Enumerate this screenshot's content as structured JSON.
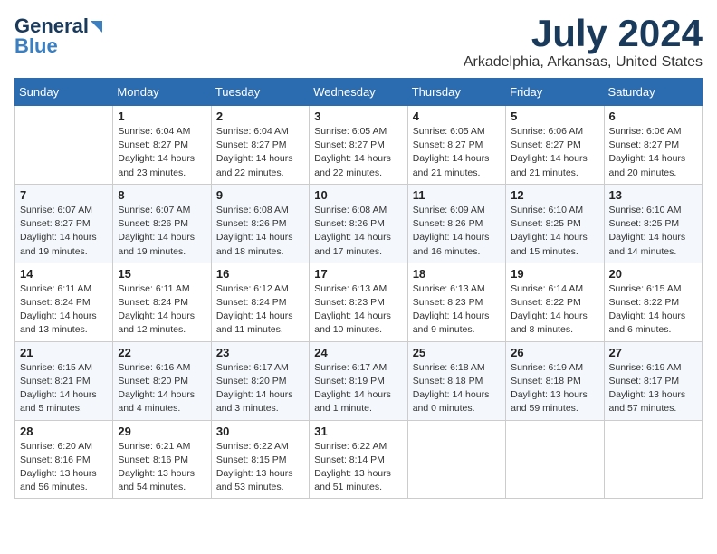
{
  "logo": {
    "line1": "General",
    "line2": "Blue"
  },
  "header": {
    "month_year": "July 2024",
    "location": "Arkadelphia, Arkansas, United States"
  },
  "weekdays": [
    "Sunday",
    "Monday",
    "Tuesday",
    "Wednesday",
    "Thursday",
    "Friday",
    "Saturday"
  ],
  "weeks": [
    [
      {
        "day": "",
        "info": ""
      },
      {
        "day": "1",
        "info": "Sunrise: 6:04 AM\nSunset: 8:27 PM\nDaylight: 14 hours\nand 23 minutes."
      },
      {
        "day": "2",
        "info": "Sunrise: 6:04 AM\nSunset: 8:27 PM\nDaylight: 14 hours\nand 22 minutes."
      },
      {
        "day": "3",
        "info": "Sunrise: 6:05 AM\nSunset: 8:27 PM\nDaylight: 14 hours\nand 22 minutes."
      },
      {
        "day": "4",
        "info": "Sunrise: 6:05 AM\nSunset: 8:27 PM\nDaylight: 14 hours\nand 21 minutes."
      },
      {
        "day": "5",
        "info": "Sunrise: 6:06 AM\nSunset: 8:27 PM\nDaylight: 14 hours\nand 21 minutes."
      },
      {
        "day": "6",
        "info": "Sunrise: 6:06 AM\nSunset: 8:27 PM\nDaylight: 14 hours\nand 20 minutes."
      }
    ],
    [
      {
        "day": "7",
        "info": "Sunrise: 6:07 AM\nSunset: 8:27 PM\nDaylight: 14 hours\nand 19 minutes."
      },
      {
        "day": "8",
        "info": "Sunrise: 6:07 AM\nSunset: 8:26 PM\nDaylight: 14 hours\nand 19 minutes."
      },
      {
        "day": "9",
        "info": "Sunrise: 6:08 AM\nSunset: 8:26 PM\nDaylight: 14 hours\nand 18 minutes."
      },
      {
        "day": "10",
        "info": "Sunrise: 6:08 AM\nSunset: 8:26 PM\nDaylight: 14 hours\nand 17 minutes."
      },
      {
        "day": "11",
        "info": "Sunrise: 6:09 AM\nSunset: 8:26 PM\nDaylight: 14 hours\nand 16 minutes."
      },
      {
        "day": "12",
        "info": "Sunrise: 6:10 AM\nSunset: 8:25 PM\nDaylight: 14 hours\nand 15 minutes."
      },
      {
        "day": "13",
        "info": "Sunrise: 6:10 AM\nSunset: 8:25 PM\nDaylight: 14 hours\nand 14 minutes."
      }
    ],
    [
      {
        "day": "14",
        "info": "Sunrise: 6:11 AM\nSunset: 8:24 PM\nDaylight: 14 hours\nand 13 minutes."
      },
      {
        "day": "15",
        "info": "Sunrise: 6:11 AM\nSunset: 8:24 PM\nDaylight: 14 hours\nand 12 minutes."
      },
      {
        "day": "16",
        "info": "Sunrise: 6:12 AM\nSunset: 8:24 PM\nDaylight: 14 hours\nand 11 minutes."
      },
      {
        "day": "17",
        "info": "Sunrise: 6:13 AM\nSunset: 8:23 PM\nDaylight: 14 hours\nand 10 minutes."
      },
      {
        "day": "18",
        "info": "Sunrise: 6:13 AM\nSunset: 8:23 PM\nDaylight: 14 hours\nand 9 minutes."
      },
      {
        "day": "19",
        "info": "Sunrise: 6:14 AM\nSunset: 8:22 PM\nDaylight: 14 hours\nand 8 minutes."
      },
      {
        "day": "20",
        "info": "Sunrise: 6:15 AM\nSunset: 8:22 PM\nDaylight: 14 hours\nand 6 minutes."
      }
    ],
    [
      {
        "day": "21",
        "info": "Sunrise: 6:15 AM\nSunset: 8:21 PM\nDaylight: 14 hours\nand 5 minutes."
      },
      {
        "day": "22",
        "info": "Sunrise: 6:16 AM\nSunset: 8:20 PM\nDaylight: 14 hours\nand 4 minutes."
      },
      {
        "day": "23",
        "info": "Sunrise: 6:17 AM\nSunset: 8:20 PM\nDaylight: 14 hours\nand 3 minutes."
      },
      {
        "day": "24",
        "info": "Sunrise: 6:17 AM\nSunset: 8:19 PM\nDaylight: 14 hours\nand 1 minute."
      },
      {
        "day": "25",
        "info": "Sunrise: 6:18 AM\nSunset: 8:18 PM\nDaylight: 14 hours\nand 0 minutes."
      },
      {
        "day": "26",
        "info": "Sunrise: 6:19 AM\nSunset: 8:18 PM\nDaylight: 13 hours\nand 59 minutes."
      },
      {
        "day": "27",
        "info": "Sunrise: 6:19 AM\nSunset: 8:17 PM\nDaylight: 13 hours\nand 57 minutes."
      }
    ],
    [
      {
        "day": "28",
        "info": "Sunrise: 6:20 AM\nSunset: 8:16 PM\nDaylight: 13 hours\nand 56 minutes."
      },
      {
        "day": "29",
        "info": "Sunrise: 6:21 AM\nSunset: 8:16 PM\nDaylight: 13 hours\nand 54 minutes."
      },
      {
        "day": "30",
        "info": "Sunrise: 6:22 AM\nSunset: 8:15 PM\nDaylight: 13 hours\nand 53 minutes."
      },
      {
        "day": "31",
        "info": "Sunrise: 6:22 AM\nSunset: 8:14 PM\nDaylight: 13 hours\nand 51 minutes."
      },
      {
        "day": "",
        "info": ""
      },
      {
        "day": "",
        "info": ""
      },
      {
        "day": "",
        "info": ""
      }
    ]
  ]
}
